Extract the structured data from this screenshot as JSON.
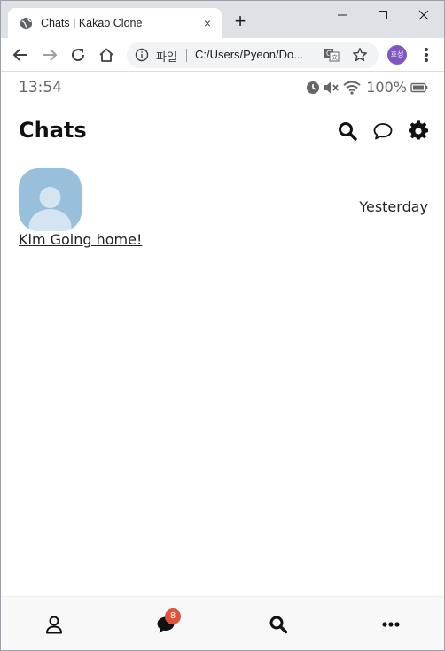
{
  "browser": {
    "tab_title": "Chats | Kakao Clone",
    "new_tab_symbol": "+",
    "tab_close_symbol": "×",
    "address_label": "파일",
    "url": "C:/Users/Pyeon/Do...",
    "profile_initials": "호성",
    "profile_color": "#7e57c2"
  },
  "status_bar": {
    "time": "13:54",
    "battery": "100%",
    "icons": [
      "clock-icon",
      "mute-icon",
      "wifi-icon",
      "battery-icon"
    ]
  },
  "header": {
    "title": "Chats",
    "actions": [
      "search-icon",
      "chat-bubble-icon",
      "gear-icon"
    ]
  },
  "chats": [
    {
      "name": "Kim",
      "last_message": "Going home!",
      "preview": "Kim Going home!",
      "time": "Yesterday",
      "avatar": "default-avatar",
      "avatar_color": "#98bfdb"
    }
  ],
  "tab_bar": {
    "items": [
      "user-icon",
      "chat-icon",
      "search-icon",
      "more-icon"
    ],
    "chat_badge": "8",
    "badge_color": "#e0533a"
  }
}
